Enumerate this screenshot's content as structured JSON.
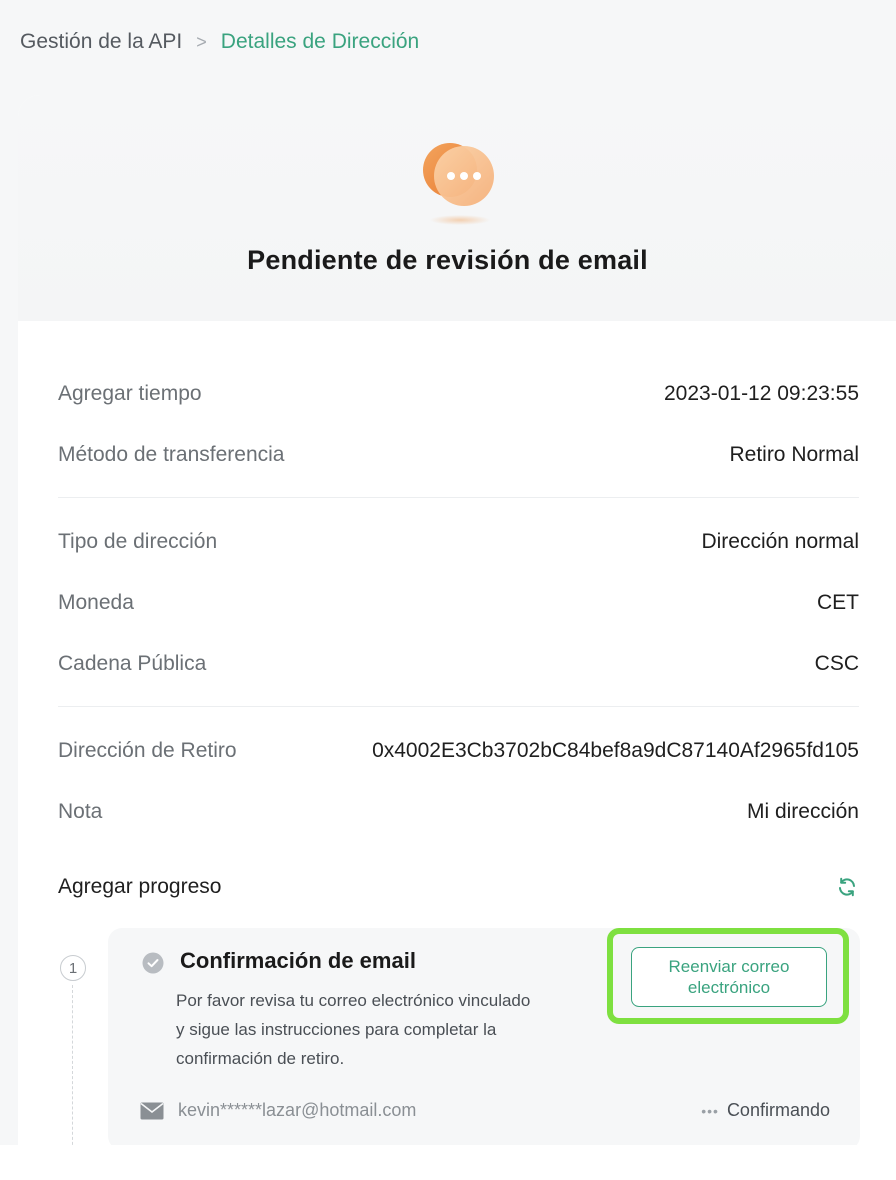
{
  "breadcrumb": {
    "parent": "Gestión de la API",
    "separator": ">",
    "current": "Detalles de Dirección"
  },
  "status": {
    "icon": "pending-dots-icon",
    "title": "Pendiente de revisión de email"
  },
  "details": {
    "add_time": {
      "label": "Agregar tiempo",
      "value": "2023-01-12 09:23:55"
    },
    "transfer_method": {
      "label": "Método de transferencia",
      "value": "Retiro Normal"
    },
    "address_type": {
      "label": "Tipo de dirección",
      "value": "Dirección normal"
    },
    "currency": {
      "label": "Moneda",
      "value": "CET"
    },
    "chain": {
      "label": "Cadena Pública",
      "value": "CSC"
    },
    "withdraw_address": {
      "label": "Dirección de Retiro",
      "value": "0x4002E3Cb3702bC84bef8a9dC87140Af2965fd105"
    },
    "note": {
      "label": "Nota",
      "value": "Mi dirección"
    }
  },
  "progress": {
    "title": "Agregar progreso",
    "refresh_icon": "refresh-icon",
    "step": {
      "number": "1",
      "title": "Confirmación de email",
      "description_lines": [
        "Por favor revisa tu correo electrónico vinculado",
        "y sigue las instrucciones para completar la",
        "confirmación de retiro."
      ],
      "resend_button": "Reenviar correo electrónico",
      "email": "kevin******lazar@hotmail.com",
      "status": "Confirmando"
    }
  },
  "colors": {
    "accent": "#3aa37f",
    "highlight": "#7ee040",
    "icon_orange": "#f0a060"
  }
}
